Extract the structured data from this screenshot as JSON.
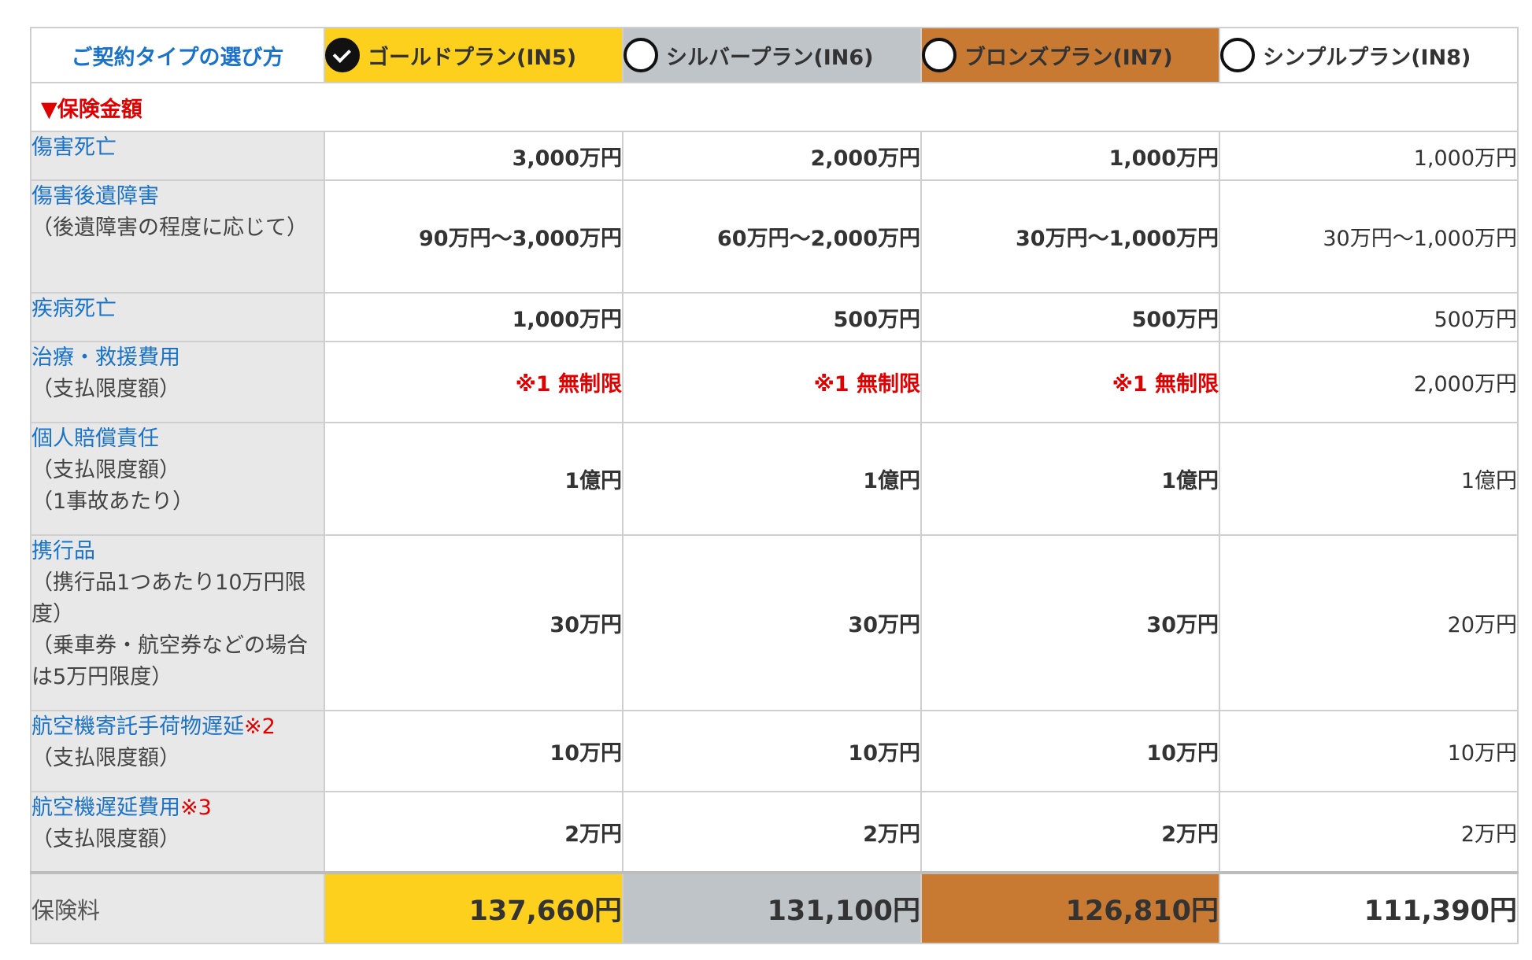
{
  "header": {
    "how_to_choose": "ご契約タイプの選び方",
    "plans": [
      {
        "name": "ゴールドプラン(IN5)",
        "selected": true,
        "color": "#fcd01c"
      },
      {
        "name": "シルバープラン(IN6)",
        "selected": false,
        "color": "#bfc4c9"
      },
      {
        "name": "ブロンズプラン(IN7)",
        "selected": false,
        "color": "#c97a32"
      },
      {
        "name": "シンプルプラン(IN8)",
        "selected": false,
        "color": "#ffffff"
      }
    ]
  },
  "section": {
    "title": "▼保険金額"
  },
  "rows": [
    {
      "label": "傷害死亡",
      "sub": [],
      "note": "",
      "values": [
        "3,000万円",
        "2,000万円",
        "1,000万円",
        "1,000万円"
      ]
    },
    {
      "label": "傷害後遺障害",
      "sub": [
        "（後遺障害の程度に応じて）"
      ],
      "note": "",
      "values": [
        "90万円〜3,000万円",
        "60万円〜2,000万円",
        "30万円〜1,000万円",
        "30万円〜1,000万円"
      ]
    },
    {
      "label": "疾病死亡",
      "sub": [],
      "note": "",
      "values": [
        "1,000万円",
        "500万円",
        "500万円",
        "500万円"
      ]
    },
    {
      "label": "治療・救援費用",
      "sub": [
        "（支払限度額）"
      ],
      "note": "",
      "values": [
        "※1 無制限",
        "※1 無制限",
        "※1 無制限",
        "2,000万円"
      ]
    },
    {
      "label": "個人賠償責任",
      "sub": [
        "（支払限度額）",
        "（1事故あたり）"
      ],
      "note": "",
      "values": [
        "1億円",
        "1億円",
        "1億円",
        "1億円"
      ]
    },
    {
      "label": "携行品",
      "sub": [
        "（携行品1つあたり10万円限度）",
        "（乗車券・航空券などの場合は5万円限度）"
      ],
      "note": "",
      "values": [
        "30万円",
        "30万円",
        "30万円",
        "20万円"
      ]
    },
    {
      "label": "航空機寄託手荷物遅延",
      "sub": [
        "（支払限度額）"
      ],
      "note": "※2",
      "values": [
        "10万円",
        "10万円",
        "10万円",
        "10万円"
      ]
    },
    {
      "label": "航空機遅延費用",
      "sub": [
        "（支払限度額）"
      ],
      "note": "※3",
      "values": [
        "2万円",
        "2万円",
        "2万円",
        "2万円"
      ]
    }
  ],
  "price": {
    "label": "保険料",
    "values": [
      "137,660円",
      "131,100円",
      "126,810円",
      "111,390円"
    ]
  }
}
